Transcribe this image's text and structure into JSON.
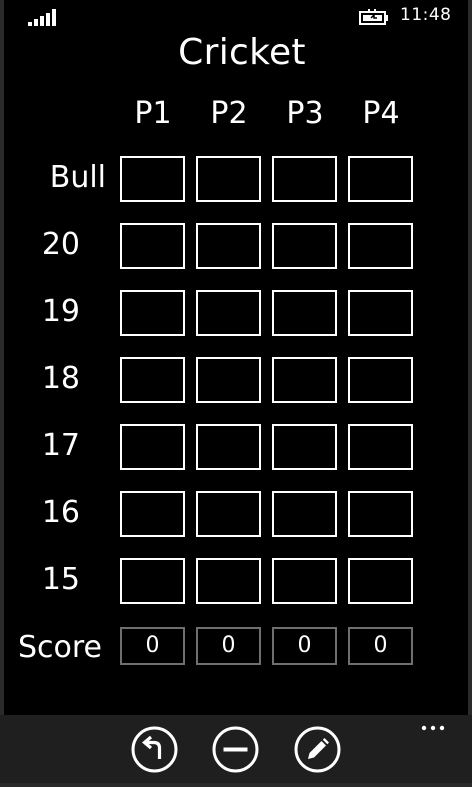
{
  "status_bar": {
    "time": "11:48"
  },
  "title": "Cricket",
  "players": [
    "P1",
    "P2",
    "P3",
    "P4"
  ],
  "rows": [
    "Bull",
    "20",
    "19",
    "18",
    "17",
    "16",
    "15"
  ],
  "score_label": "Score",
  "scores": [
    "0",
    "0",
    "0",
    "0"
  ],
  "app_bar": {
    "buttons": [
      "undo-icon",
      "minus-icon",
      "edit-icon"
    ],
    "more_label": "more"
  }
}
